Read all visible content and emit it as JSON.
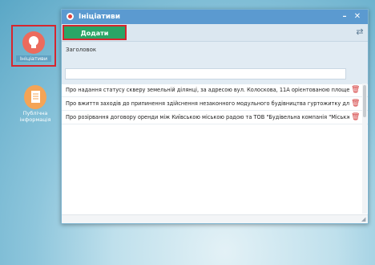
{
  "desktop": {
    "icons": [
      {
        "label": "Ініціативи"
      },
      {
        "label": "Публічна інформація"
      }
    ]
  },
  "window": {
    "title": "Ініціативи",
    "minimize": "–",
    "close": "✕",
    "toolbar": {
      "add_label": "Додати",
      "refresh": "⇄"
    },
    "filter": {
      "label": "Заголовок",
      "value": ""
    },
    "rows": [
      {
        "text": "Про надання статусу скверу земельній ділянці, за адресою вул. Колоскова, 11А орієнтованою площею 4"
      },
      {
        "text": "Про вжиття заходів до припинення здійснення незаконного модульного будівництва гуртожитку для ст"
      },
      {
        "text": "Про розірвання договору оренди між Київською міською радою та ТОВ \"Будівельна компанія \"Міськжи"
      }
    ],
    "delete_icon": "🗑"
  },
  "colors": {
    "titlebar": "#5b9ad0",
    "add_button": "#2aa566",
    "highlight": "#d6262e",
    "delete": "#d33a3a"
  }
}
